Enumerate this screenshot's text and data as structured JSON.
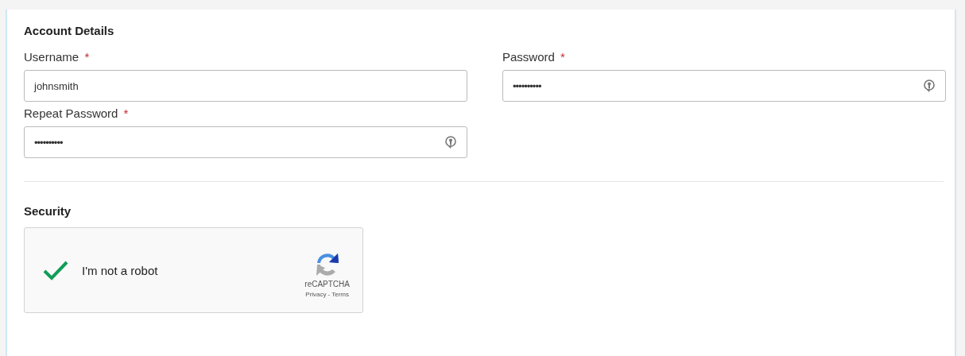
{
  "sections": [
    {
      "title": "Account Details",
      "fields": [
        {
          "kind": "text",
          "label": "Username",
          "required_mark": "*",
          "value": "johnsmith"
        },
        {
          "kind": "password",
          "label": "Password",
          "required_mark": "*",
          "value": "••••••••••"
        },
        {
          "kind": "password",
          "label": "Repeat Password",
          "required_mark": "*",
          "value": "••••••••••"
        }
      ]
    },
    {
      "title": "Security",
      "captcha": {
        "checked": true,
        "label": "I'm not a robot",
        "brand": "reCAPTCHA",
        "privacy_link": "Privacy",
        "separator": "-",
        "terms_link": "Terms"
      }
    }
  ]
}
